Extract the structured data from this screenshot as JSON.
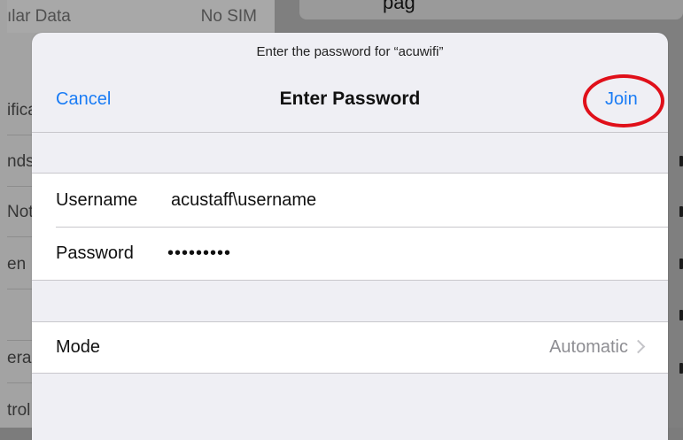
{
  "background": {
    "top_row": {
      "label": "ılar Data",
      "value": "No SIM"
    },
    "side_rows": [
      "ifica",
      "nds",
      "Not",
      "en",
      "",
      "era",
      "trol"
    ],
    "top_fragment": "pag"
  },
  "modal": {
    "prompt": "Enter the password for “acuwifi”",
    "cancel_label": "Cancel",
    "title": "Enter Password",
    "join_label": "Join",
    "username_label": "Username",
    "username_value": "acustaff\\username",
    "password_label": "Password",
    "password_value": "•••••••••",
    "mode_label": "Mode",
    "mode_value": "Automatic"
  },
  "colors": {
    "accent": "#1a7cf5",
    "highlight": "#e0101a"
  },
  "icons": {
    "mode_disclosure": "chevron-right-icon"
  }
}
